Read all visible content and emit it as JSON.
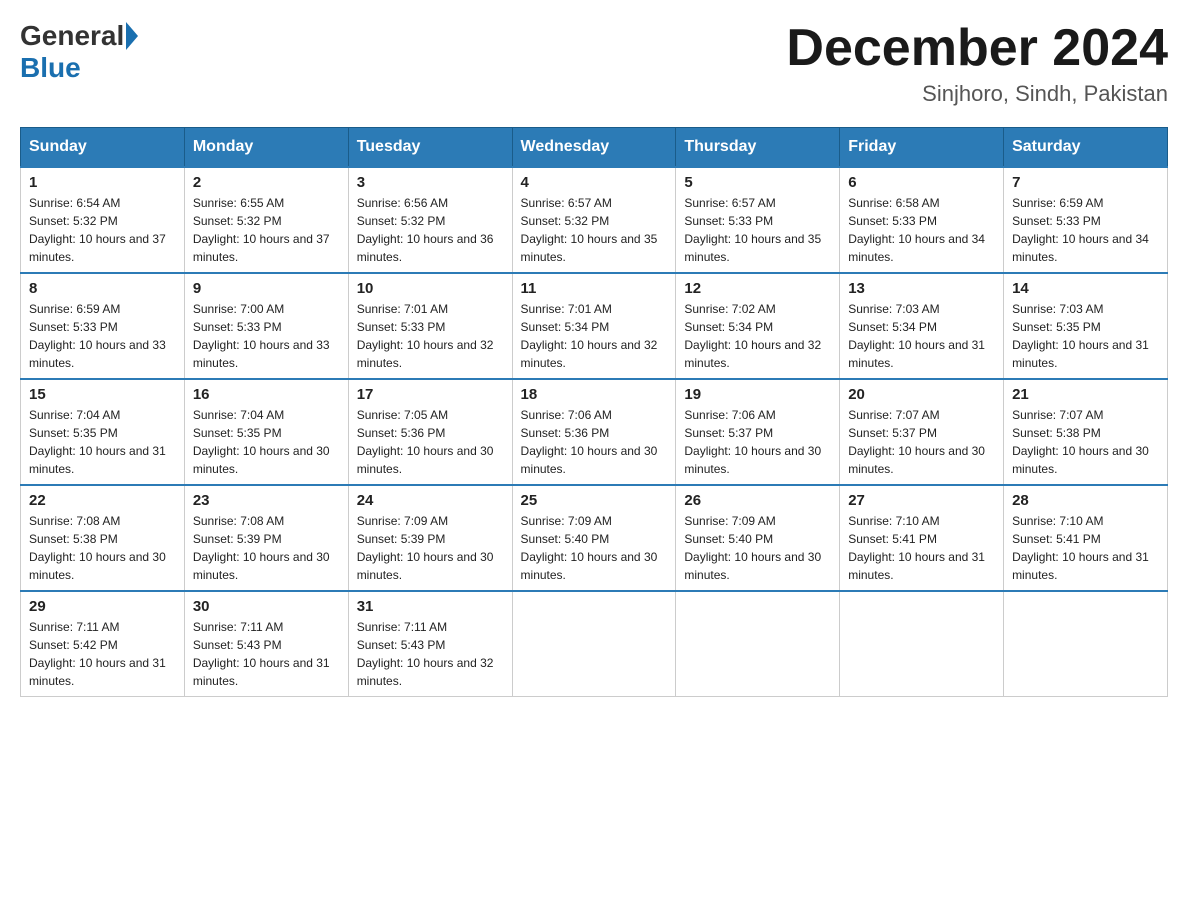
{
  "header": {
    "logo_general": "General",
    "logo_blue": "Blue",
    "title": "December 2024",
    "location": "Sinjhoro, Sindh, Pakistan"
  },
  "weekdays": [
    "Sunday",
    "Monday",
    "Tuesday",
    "Wednesday",
    "Thursday",
    "Friday",
    "Saturday"
  ],
  "weeks": [
    [
      {
        "day": "1",
        "sunrise": "6:54 AM",
        "sunset": "5:32 PM",
        "daylight": "10 hours and 37 minutes."
      },
      {
        "day": "2",
        "sunrise": "6:55 AM",
        "sunset": "5:32 PM",
        "daylight": "10 hours and 37 minutes."
      },
      {
        "day": "3",
        "sunrise": "6:56 AM",
        "sunset": "5:32 PM",
        "daylight": "10 hours and 36 minutes."
      },
      {
        "day": "4",
        "sunrise": "6:57 AM",
        "sunset": "5:32 PM",
        "daylight": "10 hours and 35 minutes."
      },
      {
        "day": "5",
        "sunrise": "6:57 AM",
        "sunset": "5:33 PM",
        "daylight": "10 hours and 35 minutes."
      },
      {
        "day": "6",
        "sunrise": "6:58 AM",
        "sunset": "5:33 PM",
        "daylight": "10 hours and 34 minutes."
      },
      {
        "day": "7",
        "sunrise": "6:59 AM",
        "sunset": "5:33 PM",
        "daylight": "10 hours and 34 minutes."
      }
    ],
    [
      {
        "day": "8",
        "sunrise": "6:59 AM",
        "sunset": "5:33 PM",
        "daylight": "10 hours and 33 minutes."
      },
      {
        "day": "9",
        "sunrise": "7:00 AM",
        "sunset": "5:33 PM",
        "daylight": "10 hours and 33 minutes."
      },
      {
        "day": "10",
        "sunrise": "7:01 AM",
        "sunset": "5:33 PM",
        "daylight": "10 hours and 32 minutes."
      },
      {
        "day": "11",
        "sunrise": "7:01 AM",
        "sunset": "5:34 PM",
        "daylight": "10 hours and 32 minutes."
      },
      {
        "day": "12",
        "sunrise": "7:02 AM",
        "sunset": "5:34 PM",
        "daylight": "10 hours and 32 minutes."
      },
      {
        "day": "13",
        "sunrise": "7:03 AM",
        "sunset": "5:34 PM",
        "daylight": "10 hours and 31 minutes."
      },
      {
        "day": "14",
        "sunrise": "7:03 AM",
        "sunset": "5:35 PM",
        "daylight": "10 hours and 31 minutes."
      }
    ],
    [
      {
        "day": "15",
        "sunrise": "7:04 AM",
        "sunset": "5:35 PM",
        "daylight": "10 hours and 31 minutes."
      },
      {
        "day": "16",
        "sunrise": "7:04 AM",
        "sunset": "5:35 PM",
        "daylight": "10 hours and 30 minutes."
      },
      {
        "day": "17",
        "sunrise": "7:05 AM",
        "sunset": "5:36 PM",
        "daylight": "10 hours and 30 minutes."
      },
      {
        "day": "18",
        "sunrise": "7:06 AM",
        "sunset": "5:36 PM",
        "daylight": "10 hours and 30 minutes."
      },
      {
        "day": "19",
        "sunrise": "7:06 AM",
        "sunset": "5:37 PM",
        "daylight": "10 hours and 30 minutes."
      },
      {
        "day": "20",
        "sunrise": "7:07 AM",
        "sunset": "5:37 PM",
        "daylight": "10 hours and 30 minutes."
      },
      {
        "day": "21",
        "sunrise": "7:07 AM",
        "sunset": "5:38 PM",
        "daylight": "10 hours and 30 minutes."
      }
    ],
    [
      {
        "day": "22",
        "sunrise": "7:08 AM",
        "sunset": "5:38 PM",
        "daylight": "10 hours and 30 minutes."
      },
      {
        "day": "23",
        "sunrise": "7:08 AM",
        "sunset": "5:39 PM",
        "daylight": "10 hours and 30 minutes."
      },
      {
        "day": "24",
        "sunrise": "7:09 AM",
        "sunset": "5:39 PM",
        "daylight": "10 hours and 30 minutes."
      },
      {
        "day": "25",
        "sunrise": "7:09 AM",
        "sunset": "5:40 PM",
        "daylight": "10 hours and 30 minutes."
      },
      {
        "day": "26",
        "sunrise": "7:09 AM",
        "sunset": "5:40 PM",
        "daylight": "10 hours and 30 minutes."
      },
      {
        "day": "27",
        "sunrise": "7:10 AM",
        "sunset": "5:41 PM",
        "daylight": "10 hours and 31 minutes."
      },
      {
        "day": "28",
        "sunrise": "7:10 AM",
        "sunset": "5:41 PM",
        "daylight": "10 hours and 31 minutes."
      }
    ],
    [
      {
        "day": "29",
        "sunrise": "7:11 AM",
        "sunset": "5:42 PM",
        "daylight": "10 hours and 31 minutes."
      },
      {
        "day": "30",
        "sunrise": "7:11 AM",
        "sunset": "5:43 PM",
        "daylight": "10 hours and 31 minutes."
      },
      {
        "day": "31",
        "sunrise": "7:11 AM",
        "sunset": "5:43 PM",
        "daylight": "10 hours and 32 minutes."
      },
      null,
      null,
      null,
      null
    ]
  ]
}
